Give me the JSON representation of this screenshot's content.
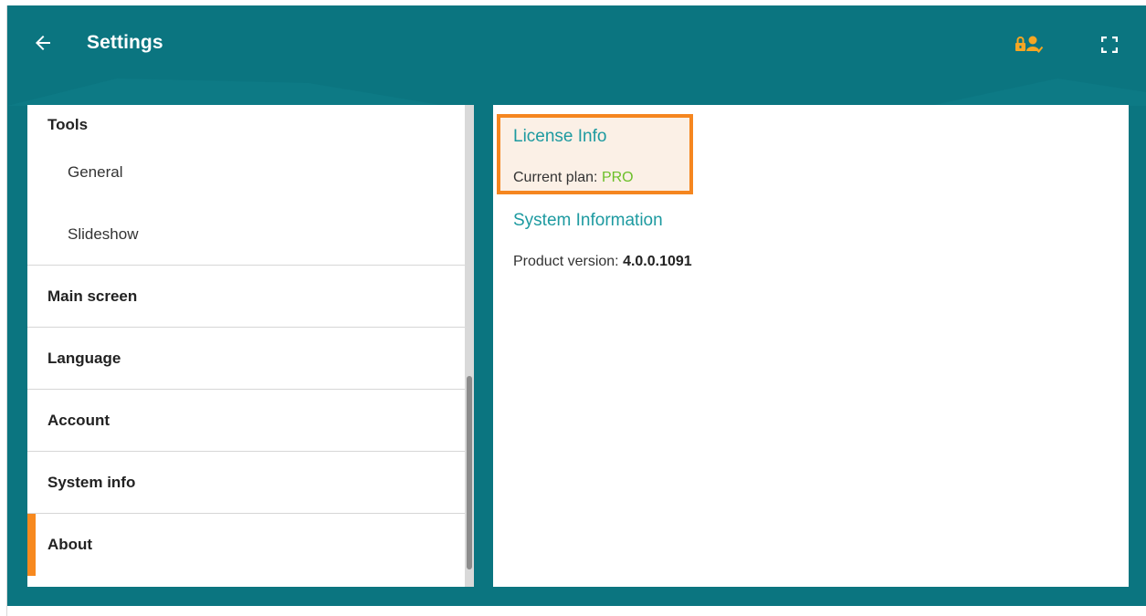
{
  "header": {
    "title": "Settings",
    "icons": {
      "back": "arrow-left-icon",
      "license": "lock-user-icon",
      "fullscreen": "fullscreen-icon"
    },
    "license_icon_color": "#f5a623"
  },
  "sidebar": {
    "items": [
      {
        "label": "Tools",
        "kind": "group"
      },
      {
        "label": "General",
        "kind": "sub"
      },
      {
        "label": "Slideshow",
        "kind": "sub"
      },
      {
        "label": "Main screen",
        "kind": "top"
      },
      {
        "label": "Language",
        "kind": "top"
      },
      {
        "label": "Account",
        "kind": "top"
      },
      {
        "label": "System info",
        "kind": "top"
      },
      {
        "label": "About",
        "kind": "top",
        "active": true
      }
    ]
  },
  "content": {
    "license": {
      "title": "License Info",
      "plan_label": "Current plan:",
      "plan_value": "PRO"
    },
    "system": {
      "title": "System Information",
      "version_label": "Product version:",
      "version_value": "4.0.0.1091"
    }
  },
  "colors": {
    "app_background": "#0b7580",
    "accent_orange": "#f5861f",
    "section_title": "#1d9aa0",
    "plan_value": "#6cbf2a"
  }
}
